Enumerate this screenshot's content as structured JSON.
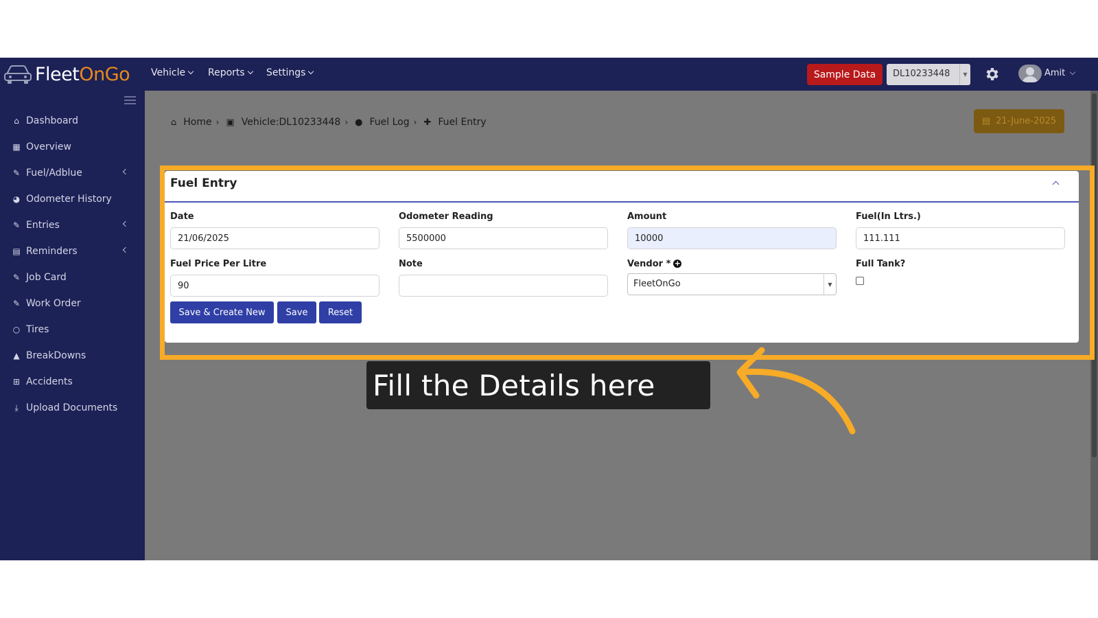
{
  "app": {
    "brand_part1": "Fleet",
    "brand_part2": "OnGo"
  },
  "topnav": {
    "vehicle": "Vehicle",
    "reports": "Reports",
    "settings": "Settings",
    "sample_data": "Sample Data",
    "vehicle_selected": "DL10233448",
    "user": "Amit"
  },
  "sidebar": {
    "items": [
      {
        "label": "Dashboard",
        "icon": "home-icon"
      },
      {
        "label": "Overview",
        "icon": "grid-icon"
      },
      {
        "label": "Fuel/Adblue",
        "icon": "edit-icon"
      },
      {
        "label": "Odometer History",
        "icon": "gauge-icon"
      },
      {
        "label": "Entries",
        "icon": "edit-icon"
      },
      {
        "label": "Reminders",
        "icon": "calendar-icon"
      },
      {
        "label": "Job Card",
        "icon": "edit-icon"
      },
      {
        "label": "Work Order",
        "icon": "edit-icon"
      },
      {
        "label": "Tires",
        "icon": "circle-icon"
      },
      {
        "label": "BreakDowns",
        "icon": "warning-icon"
      },
      {
        "label": "Accidents",
        "icon": "plus-square-icon"
      },
      {
        "label": "Upload Documents",
        "icon": "download-icon"
      }
    ]
  },
  "breadcrumb": {
    "home": "Home",
    "vehicle": "Vehicle:DL10233448",
    "fuel_log": "Fuel Log",
    "fuel_entry": "Fuel Entry"
  },
  "date_badge": "21-June-2025",
  "form": {
    "title": "Fuel Entry",
    "date": {
      "label": "Date",
      "value": "21/06/2025"
    },
    "odometer": {
      "label": "Odometer Reading",
      "value": "5500000"
    },
    "amount": {
      "label": "Amount",
      "value": "10000"
    },
    "fuel": {
      "label": "Fuel(In Ltrs.)",
      "value": "111.111"
    },
    "price": {
      "label": "Fuel Price Per Litre",
      "value": "90"
    },
    "note": {
      "label": "Note",
      "value": ""
    },
    "vendor": {
      "label": "Vendor *",
      "value": "FleetOnGo"
    },
    "full_tank": {
      "label": "Full Tank?",
      "checked": false
    },
    "buttons": {
      "save_create_new": "Save & Create New",
      "save": "Save",
      "reset": "Reset"
    }
  },
  "callout": "Fill the Details here",
  "colors": {
    "navy": "#1c2156",
    "accent_orange": "#f7ab27",
    "button_blue": "#2f3fa6",
    "sample_red": "#b8191b"
  }
}
